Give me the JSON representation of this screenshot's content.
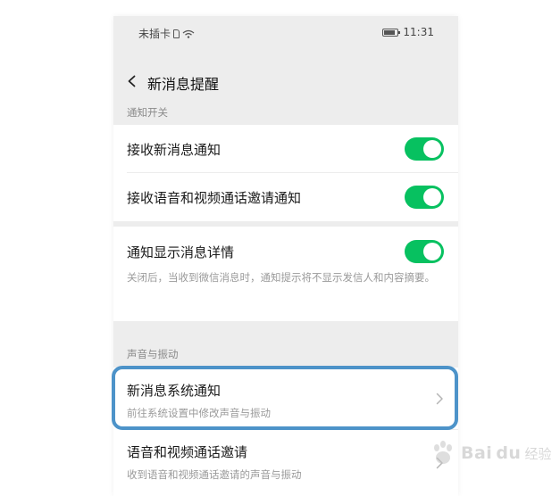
{
  "status_bar": {
    "carrier": "未插卡",
    "time": "11:31"
  },
  "header": {
    "title": "新消息提醒"
  },
  "sections": {
    "notification_switch": "通知开关",
    "sound_vibration": "声音与振动"
  },
  "items": {
    "receive_new_message": {
      "title": "接收新消息通知",
      "enabled": true
    },
    "receive_call_invite": {
      "title": "接收语音和视频通话邀请通知",
      "enabled": true
    },
    "show_details": {
      "title": "通知显示消息详情",
      "desc": "关闭后，当收到微信消息时，通知提示将不显示发信人和内容摘要。",
      "enabled": true
    },
    "system_notification": {
      "title": "新消息系统通知",
      "desc": "前往系统设置中修改声音与振动"
    },
    "call_invite_sound": {
      "title": "语音和视频通话邀请",
      "desc": "收到语音和视频通话邀请的声音与振动"
    }
  },
  "colors": {
    "toggle_on": "#07c160",
    "highlight": "#4d93c9",
    "page_bg": "#ededed"
  },
  "watermark": {
    "brand": "Bai",
    "brand_suffix": "du",
    "sub": "经验"
  }
}
